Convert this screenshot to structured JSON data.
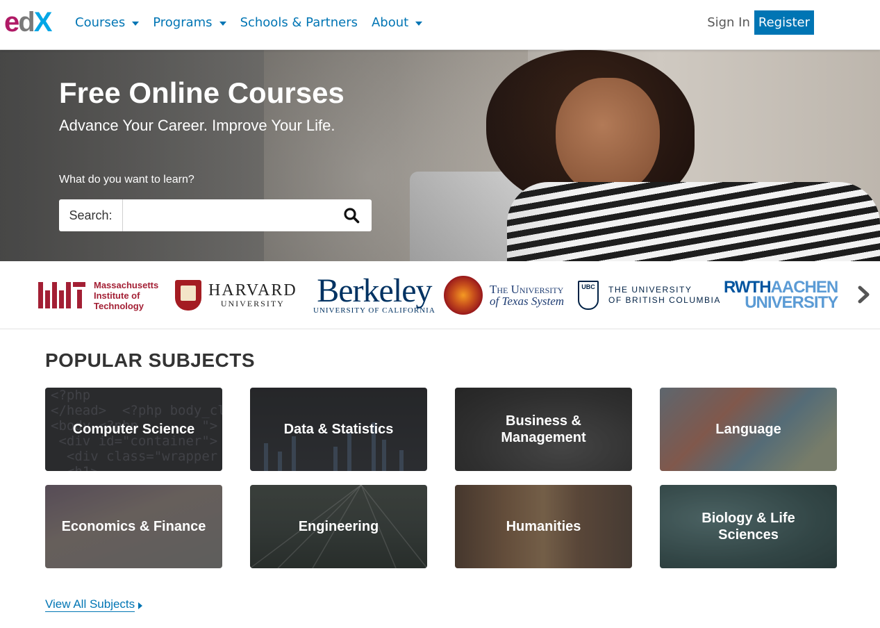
{
  "header": {
    "logo": {
      "e": "e",
      "d": "d",
      "x": "X"
    },
    "nav": [
      {
        "label": "Courses",
        "has_dropdown": true
      },
      {
        "label": "Programs",
        "has_dropdown": true
      },
      {
        "label": "Schools & Partners",
        "has_dropdown": false
      },
      {
        "label": "About",
        "has_dropdown": true
      }
    ],
    "sign_in": "Sign In",
    "register": "Register"
  },
  "hero": {
    "title": "Free Online Courses",
    "subtitle": "Advance Your Career. Improve Your Life.",
    "prompt": "What do you want to learn?",
    "search_label": "Search:",
    "search_value": "",
    "search_icon": "search-icon"
  },
  "partners": {
    "mit": {
      "name_line1": "Massachusetts",
      "name_line2": "Institute of",
      "name_line3": "Technology"
    },
    "harvard": {
      "name": "HARVARD",
      "sub": "UNIVERSITY"
    },
    "berkeley": {
      "name": "Berkeley",
      "sub": "UNIVERSITY OF CALIFORNIA"
    },
    "texas": {
      "line1": "The University",
      "line2": "of Texas System"
    },
    "ubc": {
      "badge": "UBC",
      "line1": "THE UNIVERSITY",
      "line2": "OF BRITISH COLUMBIA"
    },
    "rwth": {
      "part1": "RWTH",
      "part2": "AACHEN",
      "line2": "UNIVERSITY"
    },
    "next_icon": "chevron-right-icon"
  },
  "subjects": {
    "title": "POPULAR SUBJECTS",
    "tiles": [
      {
        "label": "Computer Science"
      },
      {
        "label": "Data & Statistics"
      },
      {
        "label": "Business & Management"
      },
      {
        "label": "Language"
      },
      {
        "label": "Economics & Finance"
      },
      {
        "label": "Engineering"
      },
      {
        "label": "Humanities"
      },
      {
        "label": "Biology & Life Sciences"
      }
    ],
    "view_all": "View All Subjects"
  },
  "colors": {
    "brand_blue": "#0075b4",
    "edx_magenta": "#b01a66",
    "edx_cyan": "#00a6e6"
  }
}
